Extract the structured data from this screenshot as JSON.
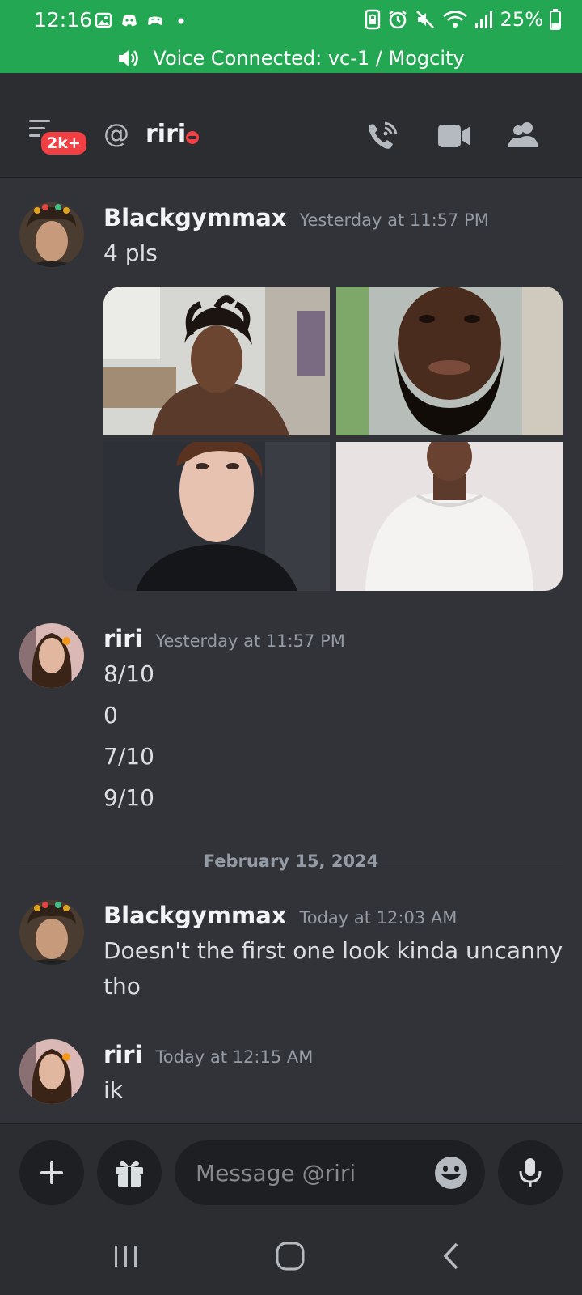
{
  "status_bar": {
    "time": "12:16",
    "battery": "25%",
    "voice_text": "Voice Connected: vc-1 / Mogcity"
  },
  "header": {
    "badge": "2k+",
    "at_symbol": "@",
    "dm_name": "riri"
  },
  "messages": [
    {
      "author": "Blackgymmax",
      "time": "Yesterday at 11:57 PM",
      "lines": [
        "4 pls"
      ]
    },
    {
      "author": "riri",
      "time": "Yesterday at 11:57 PM",
      "lines": [
        "8/10",
        "0",
        "7/10",
        "9/10"
      ]
    },
    {
      "author": "Blackgymmax",
      "time": "Today at 12:03 AM",
      "lines": [
        "Doesn't the first one look kinda uncanny",
        "tho"
      ]
    },
    {
      "author": "riri",
      "time": "Today at 12:15 AM",
      "lines": [
        "ik"
      ]
    }
  ],
  "date_divider": "February 15, 2024",
  "composer": {
    "placeholder": "Message @riri"
  },
  "colors": {
    "status_green": "#24a753",
    "background": "#313338",
    "header_bg": "#2b2d31",
    "dnd_red": "#f23f43"
  }
}
